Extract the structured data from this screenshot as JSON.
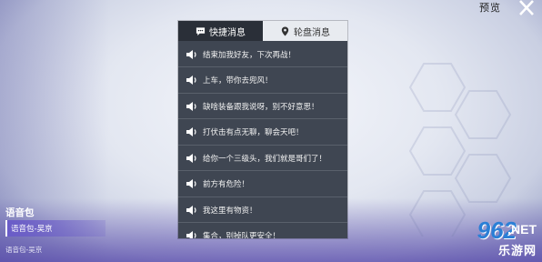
{
  "header": {
    "preview_label": "预览"
  },
  "tabs": [
    {
      "label": "快捷消息",
      "active": true,
      "icon": "chat-bubble-icon"
    },
    {
      "label": "轮盘消息",
      "active": false,
      "icon": "location-pin-icon"
    }
  ],
  "messages": [
    "结束加我好友，下次再战！",
    "上车，带你去兜风！",
    "缺啥装备跟我说呀，别不好意思！",
    "打伏击有点无聊，聊会天吧！",
    "给你一个三级头，我们就是哥们了！",
    "前方有危险！",
    "我这里有物资！",
    "集合，别掉队更安全！"
  ],
  "voice_pack": {
    "title": "语音包",
    "selected": "语音包-吴京",
    "current": "语音包-吴京"
  },
  "watermark": {
    "number": "962",
    "suffix": ".NET",
    "site": "乐游网"
  },
  "colors": {
    "panel_bg": "#3f4652",
    "tab_active_bg": "#2a2f38",
    "tab_inactive_bg": "#e8ebf0",
    "voice_highlight": "#6a5cc8",
    "watermark_blue": "#2b7fd6"
  }
}
